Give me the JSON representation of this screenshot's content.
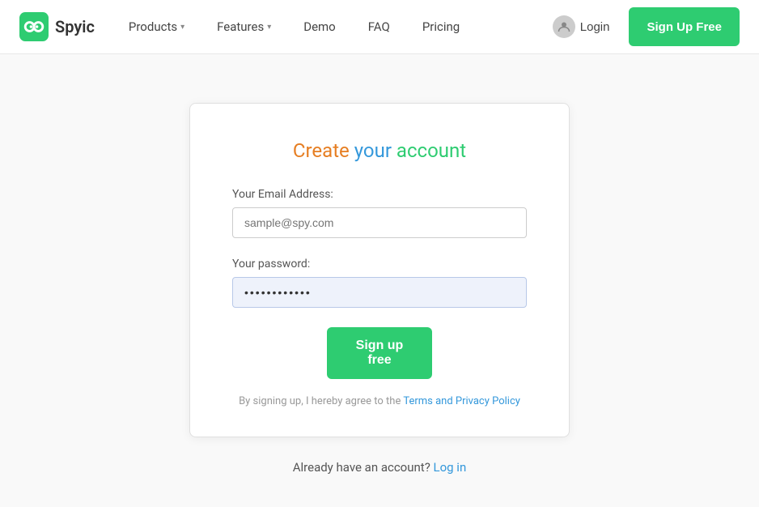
{
  "brand": {
    "name": "Spyic",
    "logo_alt": "Spyic infinity logo"
  },
  "navbar": {
    "links": [
      {
        "label": "Products",
        "has_dropdown": true
      },
      {
        "label": "Features",
        "has_dropdown": true
      },
      {
        "label": "Demo",
        "has_dropdown": false
      },
      {
        "label": "FAQ",
        "has_dropdown": false
      },
      {
        "label": "Pricing",
        "has_dropdown": false
      }
    ],
    "login_label": "Login",
    "signup_label": "Sign Up Free"
  },
  "card": {
    "title_word1": "Create",
    "title_word2": "your",
    "title_word3": "account",
    "email_label": "Your Email Address:",
    "email_placeholder": "sample@spy.com",
    "password_label": "Your password:",
    "password_value": "············",
    "signup_btn_label": "Sign up free",
    "terms_prefix": "By signing up, I hereby agree to the",
    "terms_link_label": "Terms and Privacy Policy"
  },
  "footer": {
    "already_text": "Already have an account?",
    "login_link_label": "Log in"
  }
}
